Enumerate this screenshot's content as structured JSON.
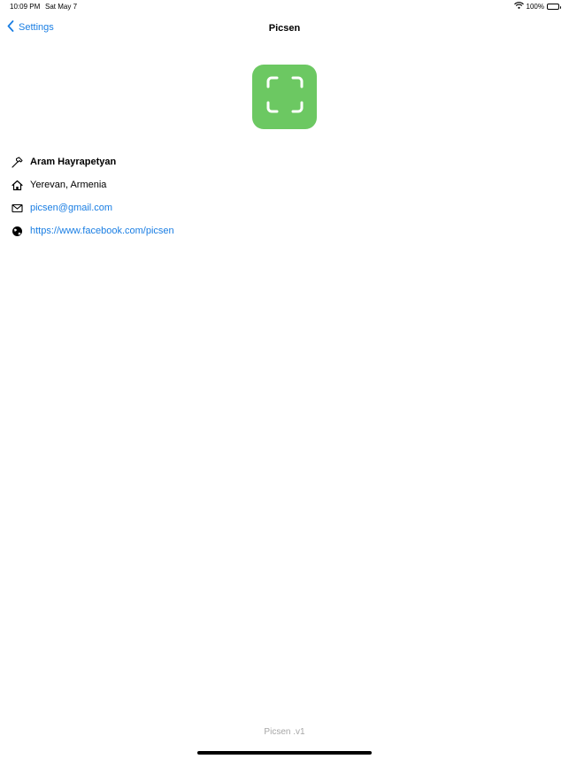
{
  "status_bar": {
    "time": "10:09 PM",
    "date": "Sat May 7",
    "battery_text": "100%",
    "icons": [
      "wifi-icon",
      "battery-icon"
    ]
  },
  "nav": {
    "back_label": "Settings",
    "title": "Picsen"
  },
  "app_icon": {
    "color": "#6cc862",
    "icon": "scan-frame-icon"
  },
  "info": {
    "name": "Aram Hayrapetyan",
    "location": "Yerevan, Armenia",
    "email": "picsen@gmail.com",
    "website": "https://www.facebook.com/picsen"
  },
  "footer": {
    "version": "Picsen .v1"
  },
  "colors": {
    "accent": "#1a7ee3",
    "icon_bg": "#6cc862",
    "footer_text": "#a6a6a6"
  }
}
